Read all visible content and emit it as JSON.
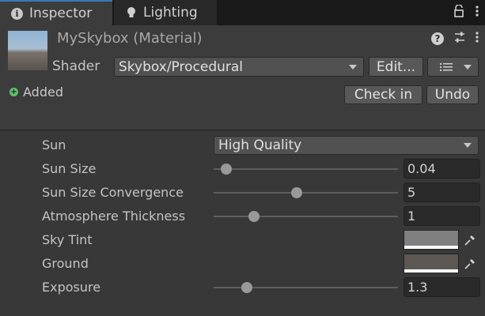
{
  "tabs": [
    {
      "label": "Inspector",
      "icon": "info-icon",
      "active": true
    },
    {
      "label": "Lighting",
      "icon": "lightbulb-icon",
      "active": false
    }
  ],
  "header": {
    "title": "MySkybox (Material)",
    "shader_label": "Shader",
    "shader_value": "Skybox/Procedural",
    "edit_label": "Edit...",
    "added_label": "Added",
    "checkin_label": "Check in",
    "undo_label": "Undo"
  },
  "properties": {
    "sun": {
      "label": "Sun",
      "value": "High Quality"
    },
    "sun_size": {
      "label": "Sun Size",
      "value": "0.04",
      "slider_fraction": 0.07
    },
    "sun_size_convergence": {
      "label": "Sun Size Convergence",
      "value": "5",
      "slider_fraction": 0.45
    },
    "atmosphere_thickness": {
      "label": "Atmosphere Thickness",
      "value": "1",
      "slider_fraction": 0.22
    },
    "sky_tint": {
      "label": "Sky Tint",
      "color": "#808080"
    },
    "ground": {
      "label": "Ground",
      "color": "#5e5854"
    },
    "exposure": {
      "label": "Exposure",
      "value": "1.3",
      "slider_fraction": 0.18
    }
  },
  "colors": {
    "accent": "#3a79bb",
    "panel_bg": "#383838",
    "added_green": "#5ec26a"
  }
}
